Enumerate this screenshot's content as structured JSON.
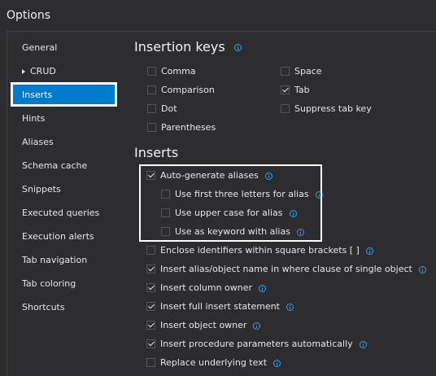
{
  "window": {
    "title": "Options"
  },
  "sidebar": {
    "items": [
      {
        "label": "General"
      },
      {
        "label": "CRUD"
      },
      {
        "label": "Inserts"
      },
      {
        "label": "Hints"
      },
      {
        "label": "Aliases"
      },
      {
        "label": "Schema cache"
      },
      {
        "label": "Snippets"
      },
      {
        "label": "Executed queries"
      },
      {
        "label": "Execution alerts"
      },
      {
        "label": "Tab navigation"
      },
      {
        "label": "Tab coloring"
      },
      {
        "label": "Shortcuts"
      }
    ],
    "selected": "Inserts"
  },
  "insertion_keys": {
    "title": "Insertion keys",
    "options": [
      {
        "label": "Comma",
        "checked": false
      },
      {
        "label": "Comparison",
        "checked": false
      },
      {
        "label": "Dot",
        "checked": false
      },
      {
        "label": "Parentheses",
        "checked": false
      },
      {
        "label": "Space",
        "checked": false
      },
      {
        "label": "Tab",
        "checked": true
      },
      {
        "label": "Suppress tab key",
        "checked": false
      }
    ]
  },
  "inserts": {
    "title": "Inserts",
    "options": [
      {
        "label": "Auto-generate aliases",
        "checked": true
      },
      {
        "label": "Use first three letters for alias",
        "checked": false
      },
      {
        "label": "Use upper case for alias",
        "checked": false
      },
      {
        "label": "Use as keyword with alias",
        "checked": false
      },
      {
        "label": "Enclose identifiers within square brackets [ ]",
        "checked": false
      },
      {
        "label": "Insert alias/object name in where clause of single object",
        "checked": true
      },
      {
        "label": "Insert column owner",
        "checked": true
      },
      {
        "label": "Insert full insert statement",
        "checked": true
      },
      {
        "label": "Insert object owner",
        "checked": true
      },
      {
        "label": "Insert procedure parameters automatically",
        "checked": true
      },
      {
        "label": "Replace underlying text",
        "checked": false
      }
    ]
  },
  "colors": {
    "accent": "#007acc",
    "background": "#2d2d30",
    "info": "#3a9de5"
  }
}
